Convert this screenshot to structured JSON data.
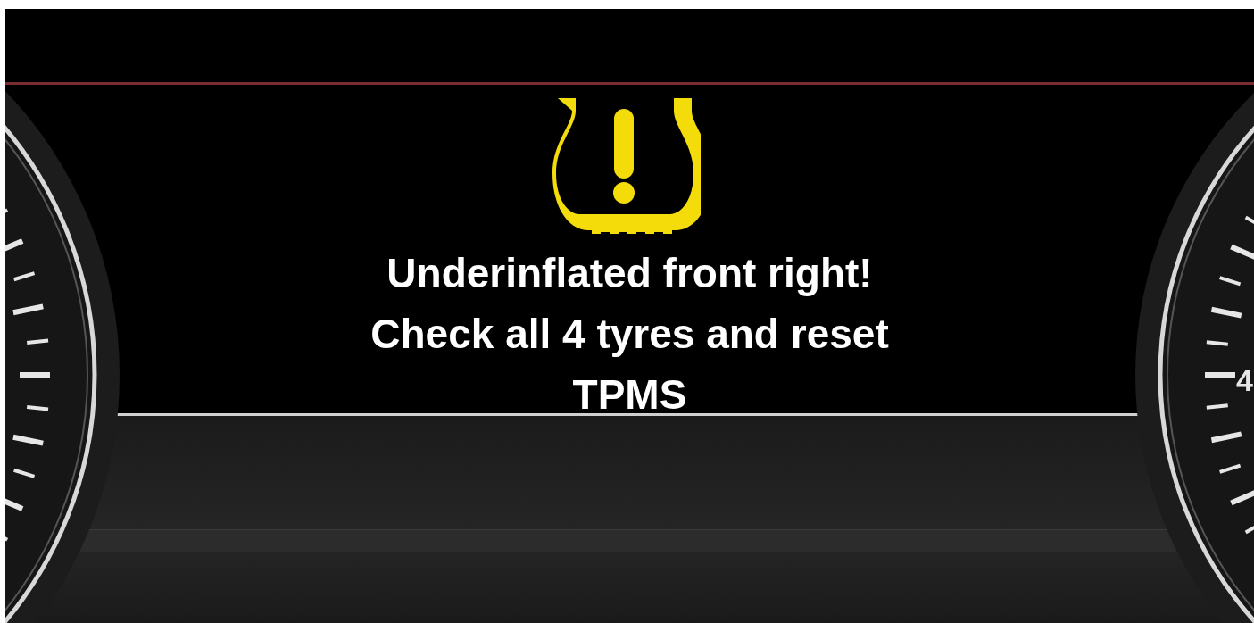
{
  "display": {
    "message": "Underinflated front right!\nCheck all 4 tyres and reset\nTPMS"
  },
  "right_gauge": {
    "label": "4"
  }
}
